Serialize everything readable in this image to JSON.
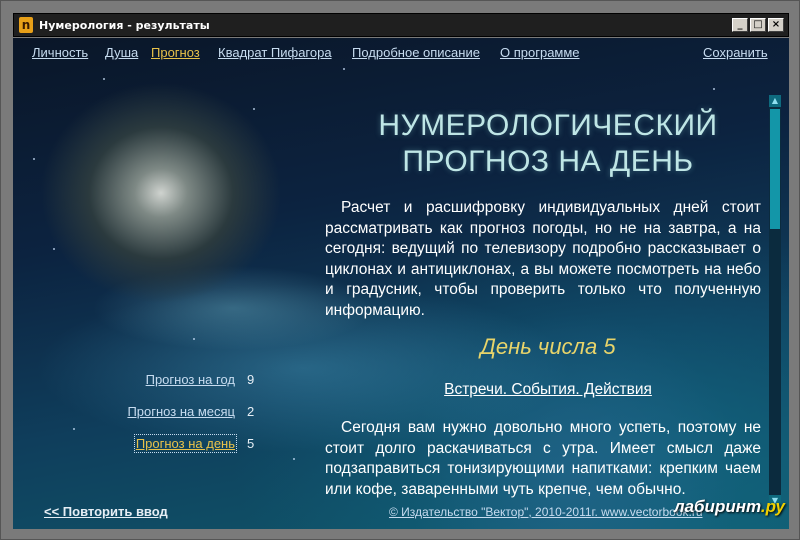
{
  "window": {
    "title": "Нумерология - результаты",
    "icon": "numerology-app-icon",
    "controls": [
      "_",
      "□",
      "×"
    ]
  },
  "nav": {
    "items": [
      {
        "label": "Личность",
        "active": false
      },
      {
        "label": "Душа",
        "active": false
      },
      {
        "label": "Прогноз",
        "active": true
      },
      {
        "label": "Квадрат Пифагора",
        "active": false
      },
      {
        "label": "Подробное описание",
        "active": false
      },
      {
        "label": "О программе",
        "active": false
      }
    ],
    "save_label": "Сохранить"
  },
  "main": {
    "heading_line1": "НУМЕРОЛОГИЧЕСКИЙ",
    "heading_line2": "ПРОГНОЗ НА ДЕНЬ",
    "intro": "Расчет и расшифровку индивидуальных дней стоит рассматривать как прогноз погоды, но не на завтра, а на сегодня: ведущий по телевизору подробно рассказывает о циклонах и антициклонах, а вы можете посмотреть на небо и градусник, чтобы проверить только что полученную информацию.",
    "day_title": "День числа 5",
    "section_title": "Встречи. События. Действия",
    "body": "Сегодня вам нужно довольно много успеть, поэтому не стоит долго раскачиваться с утра. Имеет смысл даже подзаправиться тонизирующими напитками: крепким чаем или кофе, заваренными чуть крепче, чем обычно."
  },
  "sidebar": {
    "items": [
      {
        "label": "Прогноз на год",
        "value": "9",
        "active": false
      },
      {
        "label": "Прогноз на месяц",
        "value": "2",
        "active": false
      },
      {
        "label": "Прогноз на день",
        "value": "5",
        "active": true
      }
    ]
  },
  "footer": {
    "repeat_label": "<< Повторить ввод",
    "copyright": "© Издательство \"Вектор\", 2010-2011г. www.vectorbook.ru"
  },
  "watermark": {
    "prefix": "лабиринт",
    "suffix": ".ру"
  },
  "colors": {
    "link": "#c7dcf0",
    "active_link": "#e8c24a",
    "heading": "#bfe6e6",
    "day_title": "#e8d46a"
  }
}
